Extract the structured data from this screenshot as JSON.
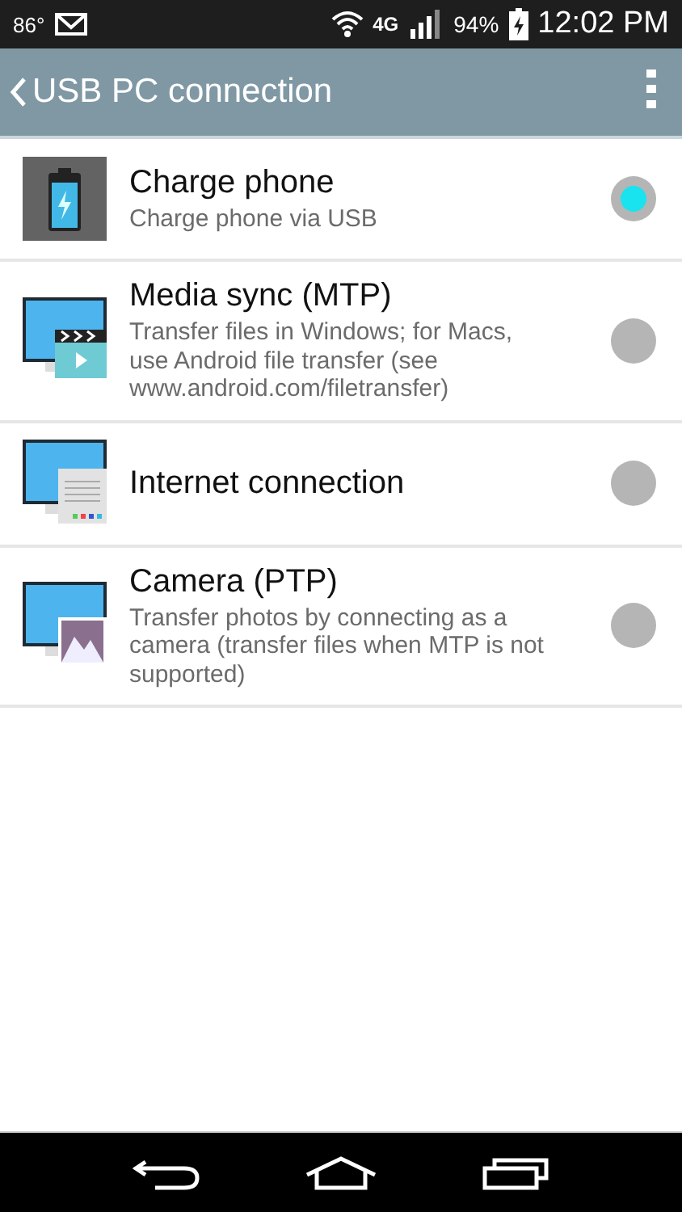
{
  "status_bar": {
    "temperature": "86°",
    "network": "4G",
    "battery": "94%",
    "time": "12:02 PM"
  },
  "app_bar": {
    "title": "USB PC connection"
  },
  "options": [
    {
      "kind": "battery",
      "title": "Charge phone",
      "description": "Charge phone via USB",
      "selected": true
    },
    {
      "kind": "media",
      "title": "Media sync (MTP)",
      "description": "Transfer files in Windows; for Macs, use Android file transfer (see www.android.com/filetransfer)",
      "selected": false
    },
    {
      "kind": "internet",
      "title": "Internet connection",
      "selected": false
    },
    {
      "kind": "camera",
      "title": "Camera (PTP)",
      "description": "Transfer photos by connecting as a camera (transfer files when MTP is not supported)",
      "selected": false
    }
  ]
}
